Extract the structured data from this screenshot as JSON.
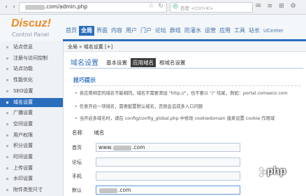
{
  "browser": {
    "url_suffix": ".com/admin.php",
    "search_placeholder": "百度 <Ctrl+K>",
    "back": "‹",
    "forward": "›"
  },
  "header": {
    "logo": "Discuz!",
    "logo_sub": "Control Panel",
    "nav": [
      "首页",
      "全局",
      "界面",
      "内容",
      "用户",
      "门户",
      "论坛",
      "群组",
      "防灌水",
      "运营",
      "应用",
      "工具",
      "站长",
      "UCenter"
    ],
    "active_nav": "全局"
  },
  "sidebar": {
    "items": [
      "站点信息",
      "注册与访问控制",
      "站点功能",
      "性能优化",
      "SEO设置",
      "域名设置",
      "广播设置",
      "空间设置",
      "用户权限",
      "积分设置",
      "时间设置",
      "上传设置",
      "水印设置",
      "附件类型尺寸"
    ],
    "active": "域名设置"
  },
  "main": {
    "breadcrumb": "全局 » 域名设置 [+]",
    "title": "域名设置",
    "tabs": [
      "基本设置",
      "应用域名",
      "根域名设置"
    ],
    "active_tab": "应用域名",
    "tips_title": "技巧提示",
    "tips": [
      "各应用绑定的域名不能相同，域名不需要添加 \"http://\"，也不要以 \"/\" 结尾，例如：portal.comsenz.com",
      "任意开启一项域名，需要配置默认域名，否则会造成多入口问题",
      "当开启多域名时，请在 config/config_global.php 中修改 cookiedomain 值来设置 cookie 作用域"
    ],
    "col_name": "名称",
    "col_domain": "域名",
    "rows": [
      {
        "label": "首页",
        "prefix": "www.",
        "suffix": ".com"
      },
      {
        "label": "论坛",
        "prefix": "",
        "suffix": ""
      },
      {
        "label": "手机",
        "prefix": "",
        "suffix": ""
      },
      {
        "label": "默认",
        "prefix": "",
        "suffix": ".com"
      }
    ]
  },
  "watermark": "php"
}
